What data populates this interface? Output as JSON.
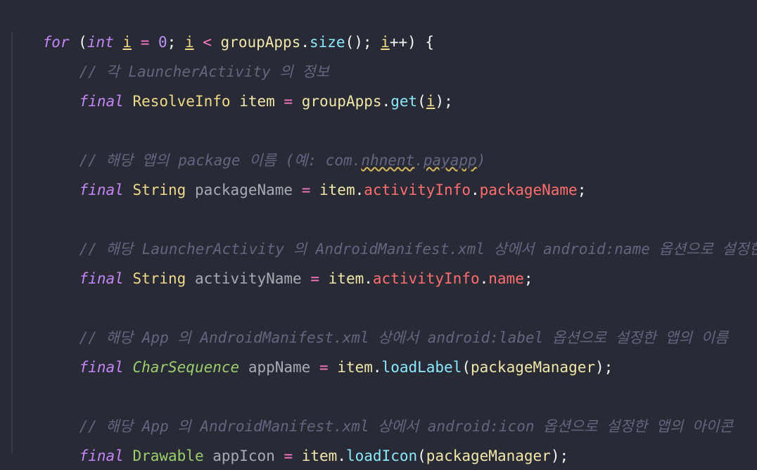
{
  "editor": {
    "lines": [
      {
        "id": "for-loop",
        "text_parts": [
          "for",
          " (",
          "int",
          " ",
          "i",
          " = ",
          "0",
          "; ",
          "i",
          " < ",
          "groupApps",
          ".",
          "size",
          "(); ",
          "i",
          "++) {"
        ]
      },
      {
        "id": "c1",
        "comment": "// 각 LauncherActivity 의 정보"
      },
      {
        "id": "l1",
        "parts": [
          "final",
          "ResolveInfo",
          "item",
          "=",
          "groupApps",
          ".",
          "get",
          "(",
          "i",
          ");"
        ]
      },
      {
        "id": "c2a",
        "comment": "// 해당 앱의 package 이름 (예: com.",
        "c2b": "nhnent",
        "c2c": ".",
        "c2d": "payapp",
        "c2e": ")"
      },
      {
        "id": "l2",
        "parts": [
          "final",
          "String",
          "packageName",
          "=",
          "item",
          ".",
          "activityInfo",
          ".",
          "packageName",
          ";"
        ]
      },
      {
        "id": "c3",
        "comment": "// 해당 LauncherActivity 의 AndroidManifest.xml 상에서 android:name 옵션으로 설정한 이름"
      },
      {
        "id": "l3",
        "parts": [
          "final",
          "String",
          "activityName",
          "=",
          "item",
          ".",
          "activityInfo",
          ".",
          "name",
          ";"
        ]
      },
      {
        "id": "c4",
        "comment": "// 해당 App 의 AndroidManifest.xml 상에서 android:label 옵션으로 설정한 앱의 이름"
      },
      {
        "id": "l4",
        "parts": [
          "final",
          "CharSequence",
          "appName",
          "=",
          "item",
          ".",
          "loadLabel",
          "(",
          "packageManager",
          ");"
        ]
      },
      {
        "id": "c5",
        "comment": "// 해당 App 의 AndroidManifest.xml 상에서 android:icon 옵션으로 설정한 앱의 아이콘"
      },
      {
        "id": "l5",
        "parts": [
          "final",
          "Drawable",
          "appIcon",
          "=",
          "item",
          ".",
          "loadIcon",
          "(",
          "packageManager",
          ");"
        ]
      },
      {
        "id": "close",
        "text": "}"
      }
    ]
  },
  "colors": {
    "background": "#282a36",
    "keyword": "#c586f8",
    "comment": "#636680",
    "field": "#ff6e6e",
    "method": "#8be9fd"
  }
}
